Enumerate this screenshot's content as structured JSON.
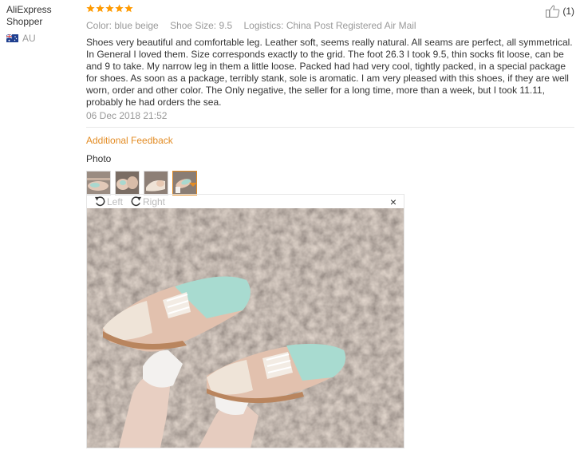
{
  "buyer": {
    "name": "AliExpress Shopper",
    "country": "AU"
  },
  "review": {
    "rating": 5,
    "helpful_count": "(1)",
    "attributes": [
      "Color: blue beige",
      "Shoe Size: 9.5",
      "Logistics: China Post Registered Air Mail"
    ],
    "text": "Shoes very beautiful and comfortable leg. Leather soft, seems really natural. All seams are perfect, all symmetrical. In General I loved them. Size corresponds exactly to the grid. The foot 26.3 I took 9.5, thin socks fit loose, can be and 9 to take. My narrow leg in them a little loose. Packed had had very cool, tightly packed, in a special package for shoes. As soon as a package, terribly stank, sole is aromatic. I am very pleased with this shoes, if they are well worn, order and other color. The Only negative, the seller for a long time, more than a week, but I took 11.11, probably he had orders the sea.",
    "date": "06 Dec 2018 21:52"
  },
  "additional_feedback": "Additional Feedback",
  "photo_label": "Photo",
  "thumbnails_count": 4,
  "active_thumbnail": 4,
  "viewer": {
    "rotate_left_label": "Left",
    "rotate_right_label": "Right",
    "close_glyph": "×"
  },
  "colors": {
    "accent": "#e38c24",
    "star": "#ff9a00",
    "muted": "#999999"
  }
}
